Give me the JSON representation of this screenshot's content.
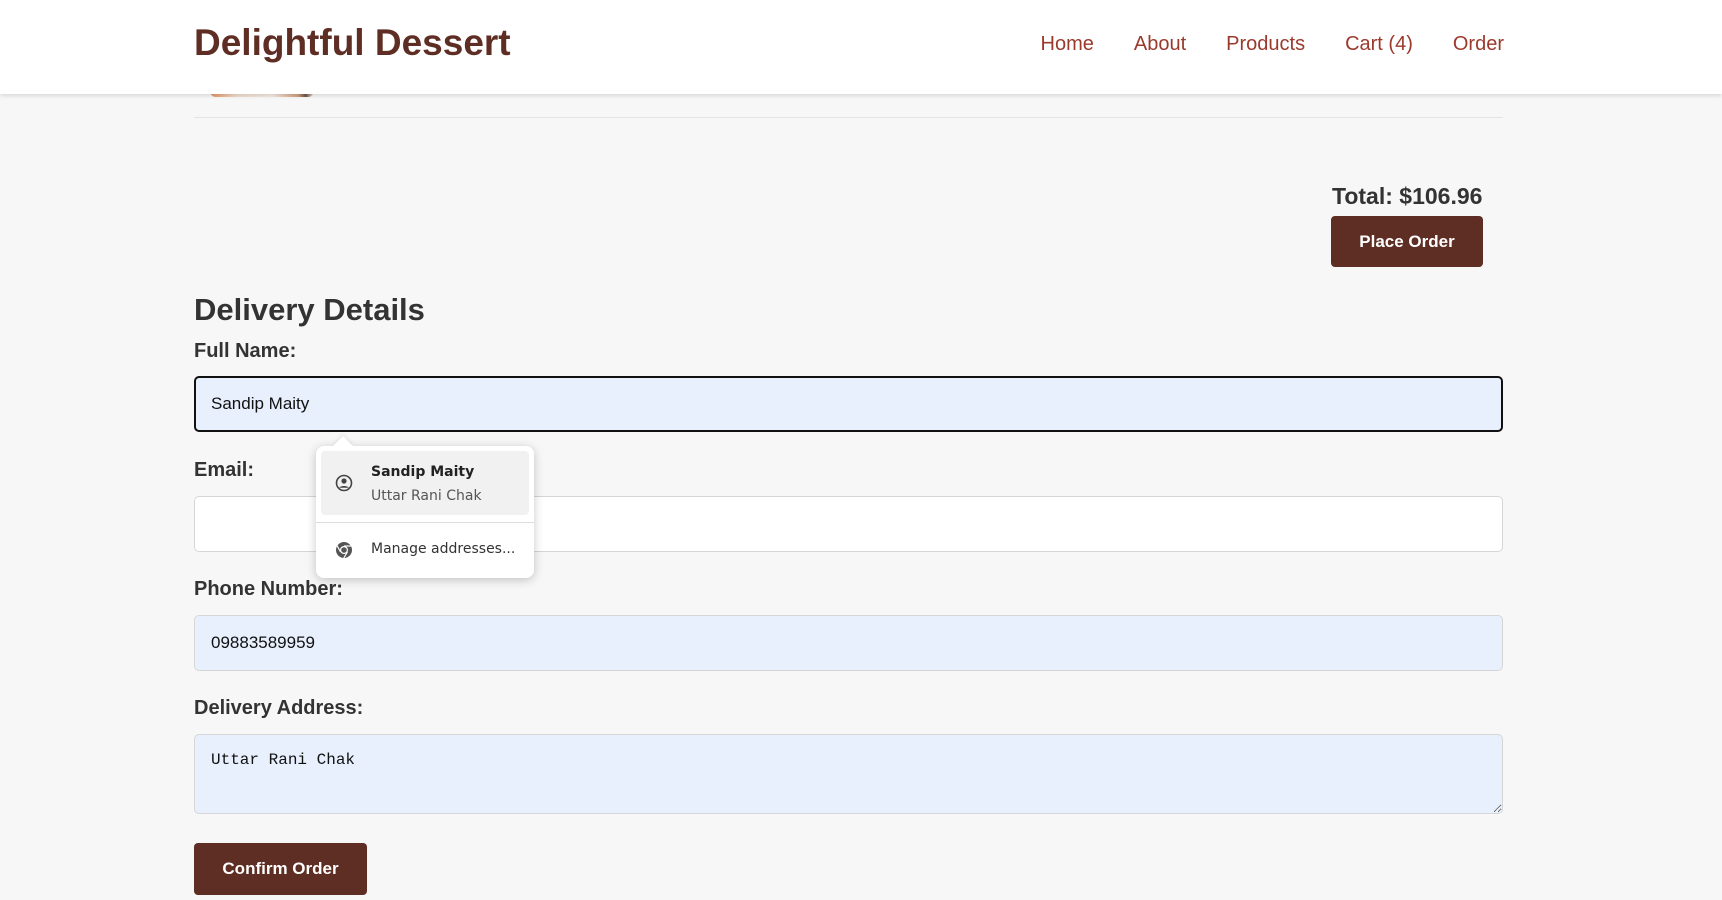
{
  "header": {
    "brand": "Delightful Dessert",
    "nav": [
      "Home",
      "About",
      "Products",
      "Cart (4)",
      "Order"
    ]
  },
  "cart": {
    "total_label": "Total: $106.96",
    "place_order_label": "Place Order"
  },
  "delivery": {
    "title": "Delivery Details",
    "full_name_label": "Full Name:",
    "full_name_value": "Sandip Maity",
    "email_label": "Email:",
    "email_value": "",
    "phone_label": "Phone Number:",
    "phone_value": "09883589959",
    "address_label": "Delivery Address:",
    "address_value": "Uttar Rani Chak",
    "confirm_label": "Confirm Order"
  },
  "autofill": {
    "suggestion_name": "Sandip Maity",
    "suggestion_address": "Uttar Rani Chak",
    "manage_label": "Manage addresses..."
  },
  "colors": {
    "brand": "#5e2d23",
    "nav_link": "#9b3a2c",
    "autofill_bg": "#e8f0fe"
  }
}
